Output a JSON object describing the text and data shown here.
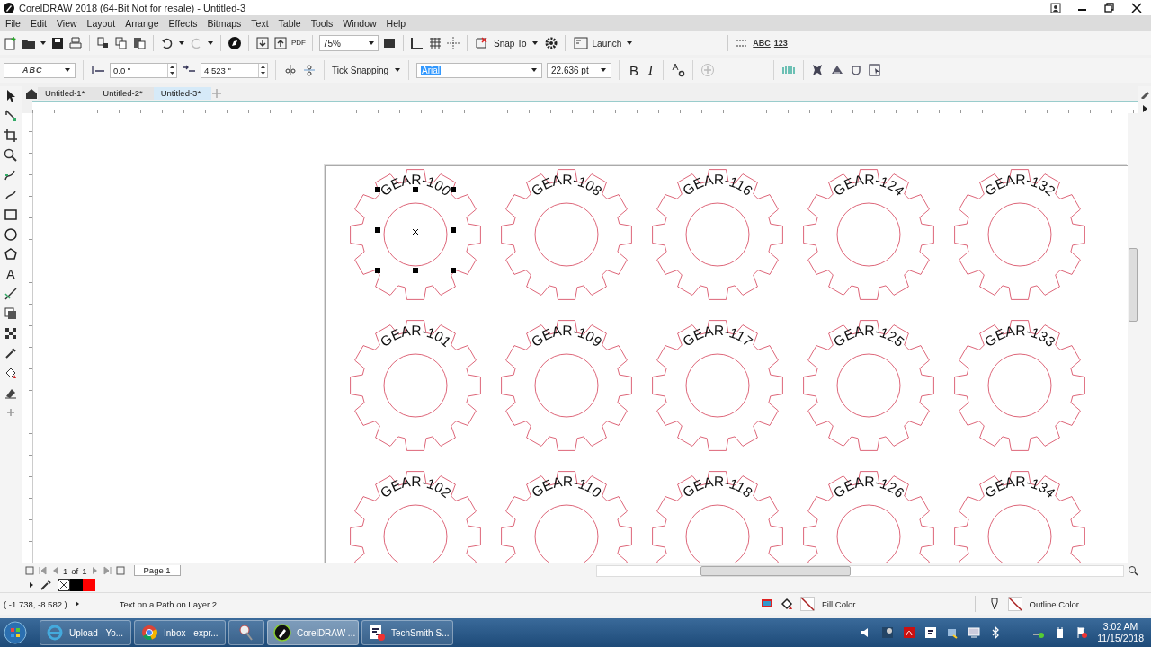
{
  "window": {
    "title": "CorelDRAW 2018 (64-Bit Not for resale) - Untitled-3"
  },
  "menu": [
    "File",
    "Edit",
    "View",
    "Layout",
    "Arrange",
    "Effects",
    "Bitmaps",
    "Text",
    "Table",
    "Tools",
    "Window",
    "Help"
  ],
  "toolbar": {
    "pdf_label": "PDF",
    "zoom": "75%",
    "snap": "Snap To",
    "launch": "Launch",
    "abc_label": "ABC",
    "num_label": "123"
  },
  "property_bar": {
    "text_style": "ABC",
    "offset": "0.0 \"",
    "distance": "4.523 \"",
    "tick_snapping": "Tick Snapping",
    "font": {
      "value": "Arial",
      "highlighted": true
    },
    "font_size": "22.636 pt",
    "bold": "B",
    "italic": "I"
  },
  "toolbox": {
    "text_tool": "A"
  },
  "doc_tabs": [
    {
      "label": "Untitled-1*",
      "selected": false
    },
    {
      "label": "Untitled-2*",
      "selected": false
    },
    {
      "label": "Untitled-3*",
      "selected": true
    }
  ],
  "gears": [
    {
      "label": "GEAR-100",
      "selected": true
    },
    {
      "label": "GEAR-108",
      "selected": false
    },
    {
      "label": "GEAR-116",
      "selected": false
    },
    {
      "label": "GEAR-124",
      "selected": false
    },
    {
      "label": "GEAR-132",
      "selected": false
    },
    {
      "label": "GEAR-101",
      "selected": false
    },
    {
      "label": "GEAR-109",
      "selected": false
    },
    {
      "label": "GEAR-117",
      "selected": false
    },
    {
      "label": "GEAR-125",
      "selected": false
    },
    {
      "label": "GEAR-133",
      "selected": false
    },
    {
      "label": "GEAR-102",
      "selected": false
    },
    {
      "label": "GEAR-110",
      "selected": false
    },
    {
      "label": "GEAR-118",
      "selected": false
    },
    {
      "label": "GEAR-126",
      "selected": false
    },
    {
      "label": "GEAR-134",
      "selected": false
    }
  ],
  "page_nav": {
    "current": "1",
    "of": "of",
    "total": "1",
    "page_tab": "Page 1"
  },
  "palette": [
    {
      "kind": "none"
    },
    {
      "kind": "swatch",
      "color": "#000000"
    },
    {
      "kind": "swatch",
      "color": "#ff0000"
    }
  ],
  "status_bar": {
    "coordinates": "( -1.738, -8.582 )",
    "object_info": "Text on a Path on Layer 2",
    "fill": "Fill Color",
    "outline": "Outline Color"
  },
  "taskbar": {
    "items": [
      {
        "kind": "ie",
        "label": "Upload - Yo...",
        "active": false
      },
      {
        "kind": "chrome",
        "label": "Inbox - expr...",
        "active": false
      },
      {
        "kind": "tool",
        "active": false
      },
      {
        "kind": "corel",
        "label": "CorelDRAW ...",
        "active": true
      },
      {
        "kind": "techsmith",
        "label": "TechSmith S...",
        "active": false
      }
    ],
    "time": "3:02 AM",
    "date": "11/15/2018"
  }
}
